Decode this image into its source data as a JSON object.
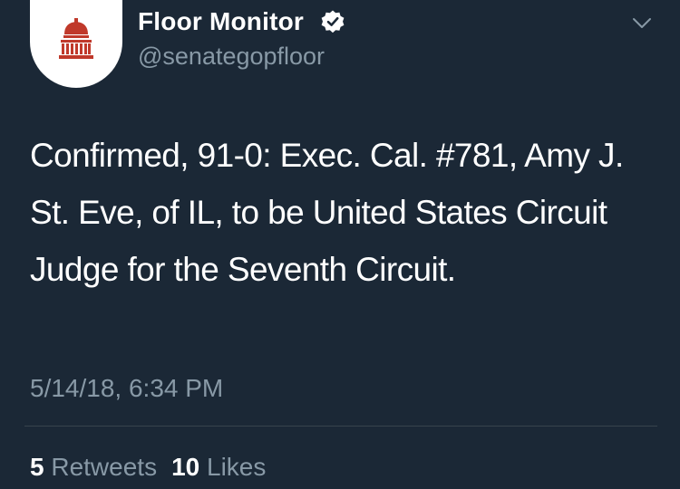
{
  "account": {
    "display_name": "Floor Monitor",
    "handle": "@senategopfloor",
    "verified": true,
    "avatar_icon": "capitol-dome-icon",
    "avatar_color": "#c0392b"
  },
  "tweet": {
    "text": "Confirmed, 91-0: Exec. Cal. #781, Amy J. St. Eve, of IL, to be United States Circuit Judge for the Seventh Circuit.",
    "timestamp": "5/14/18, 6:34 PM"
  },
  "stats": {
    "retweets_count": "5",
    "retweets_label": "Retweets",
    "likes_count": "10",
    "likes_label": "Likes"
  },
  "icons": {
    "verified": "verified-badge-icon",
    "menu": "chevron-down-icon"
  },
  "colors": {
    "background": "#1b2836",
    "secondary_text": "#8899a6",
    "divider": "#38444d"
  }
}
